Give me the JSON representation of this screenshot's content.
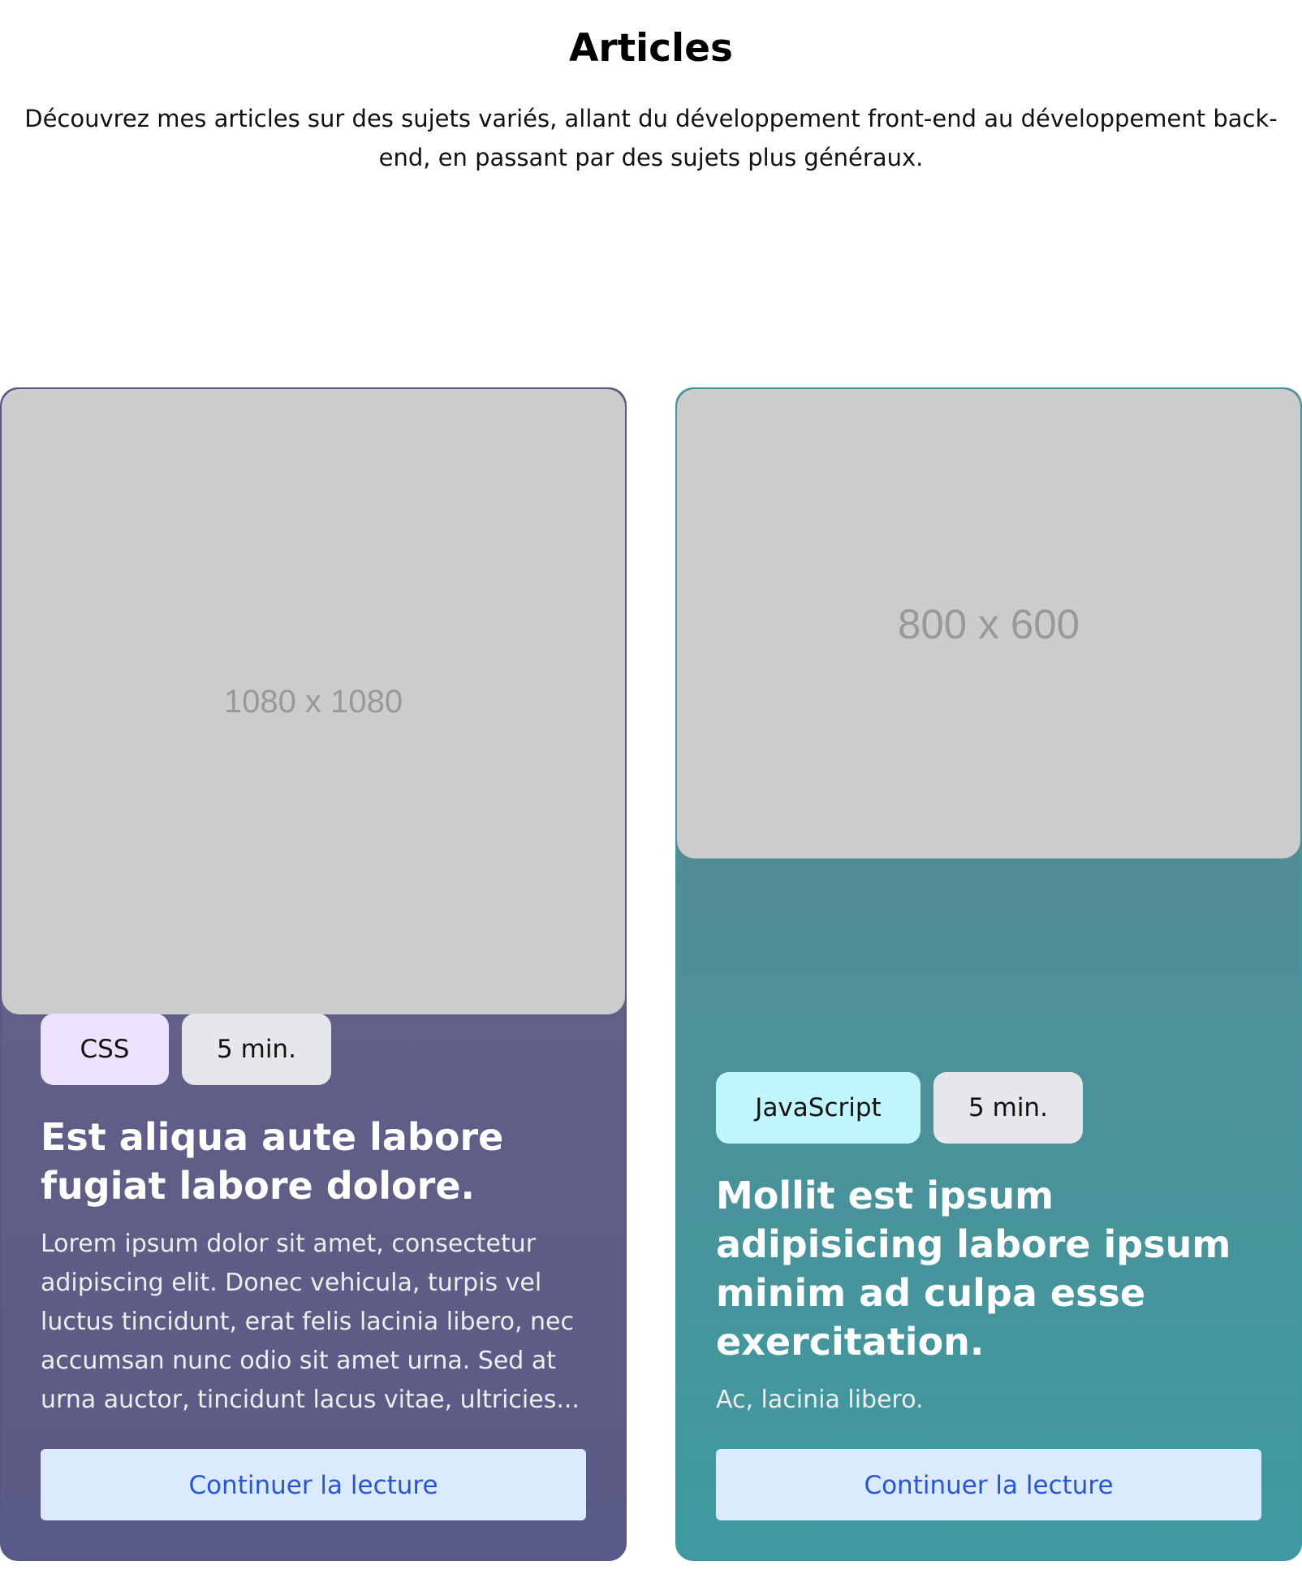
{
  "header": {
    "title": "Articles",
    "subtitle": "Découvrez mes articles sur des sujets variés, allant du développement front-end au développement back-end, en passant par des sujets plus généraux."
  },
  "articles": [
    {
      "image_label": "1080 x 1080",
      "tags": [
        "CSS",
        "5 min."
      ],
      "title": "Est aliqua aute labore fugiat labore dolore.",
      "excerpt": "Lorem ipsum dolor sit amet, consectetur adipiscing elit. Donec vehicula, turpis vel luctus tincidunt, erat felis lacinia libero, nec accumsan nunc odio sit amet urna. Sed at urna auctor, tincidunt lacus vitae, ultricies...",
      "cta": "Continuer la lecture",
      "colors": {
        "tag": "#ede3ff",
        "border": "#595789"
      }
    },
    {
      "image_label": "800 x 600",
      "tags": [
        "JavaScript",
        "5 min."
      ],
      "title": "Mollit est ipsum adipisicing labore ipsum minim ad culpa esse exercitation.",
      "excerpt": "Ac, lacinia libero.",
      "cta": "Continuer la lecture",
      "colors": {
        "tag": "#c0f6fe",
        "border": "#3c999e"
      }
    }
  ]
}
